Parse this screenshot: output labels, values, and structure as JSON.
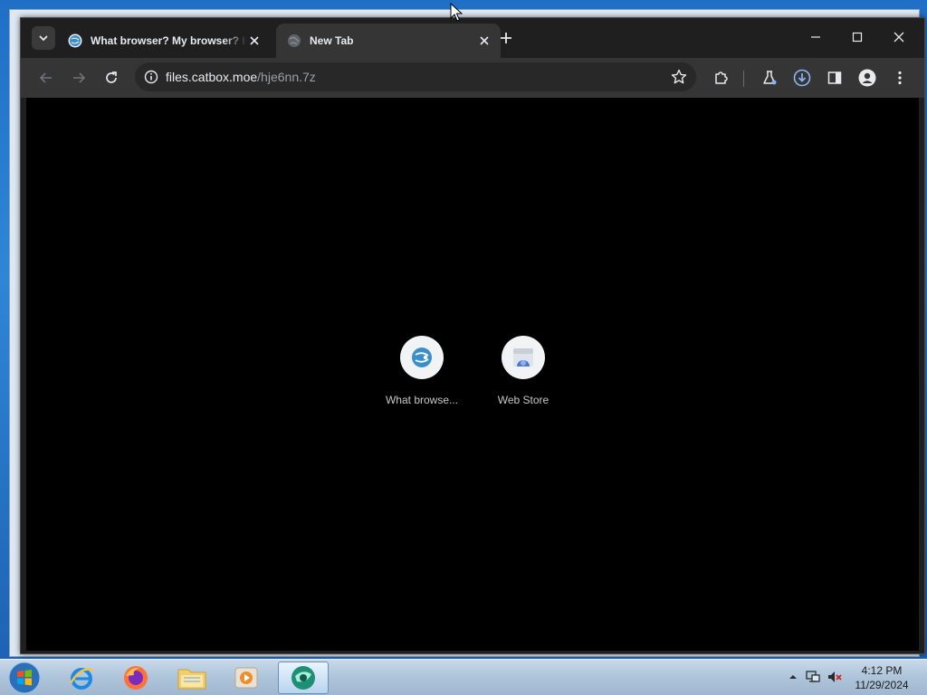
{
  "browser": {
    "tabs": [
      {
        "title": "What browser? My browser? Is",
        "favicon": "whatbrowser-globe-icon",
        "active": false
      },
      {
        "title": "New Tab",
        "favicon": "globe-icon",
        "active": true
      }
    ],
    "omnibox": {
      "url_host": "files.catbox.moe",
      "url_path": "/hje6nn.7z"
    },
    "shortcuts": [
      {
        "label": "What browse...",
        "icon": "whatbrowser-globe-icon"
      },
      {
        "label": "Web Store",
        "icon": "webstore-icon"
      }
    ],
    "accent_download": "#8ab4f8"
  },
  "taskbar": {
    "apps": [
      {
        "name": "internet-explorer-icon"
      },
      {
        "name": "firefox-icon"
      },
      {
        "name": "file-explorer-icon"
      },
      {
        "name": "media-player-icon"
      },
      {
        "name": "browser-app-icon",
        "active": true
      }
    ],
    "clock": {
      "time": "4:12 PM",
      "date": "11/29/2024"
    }
  }
}
